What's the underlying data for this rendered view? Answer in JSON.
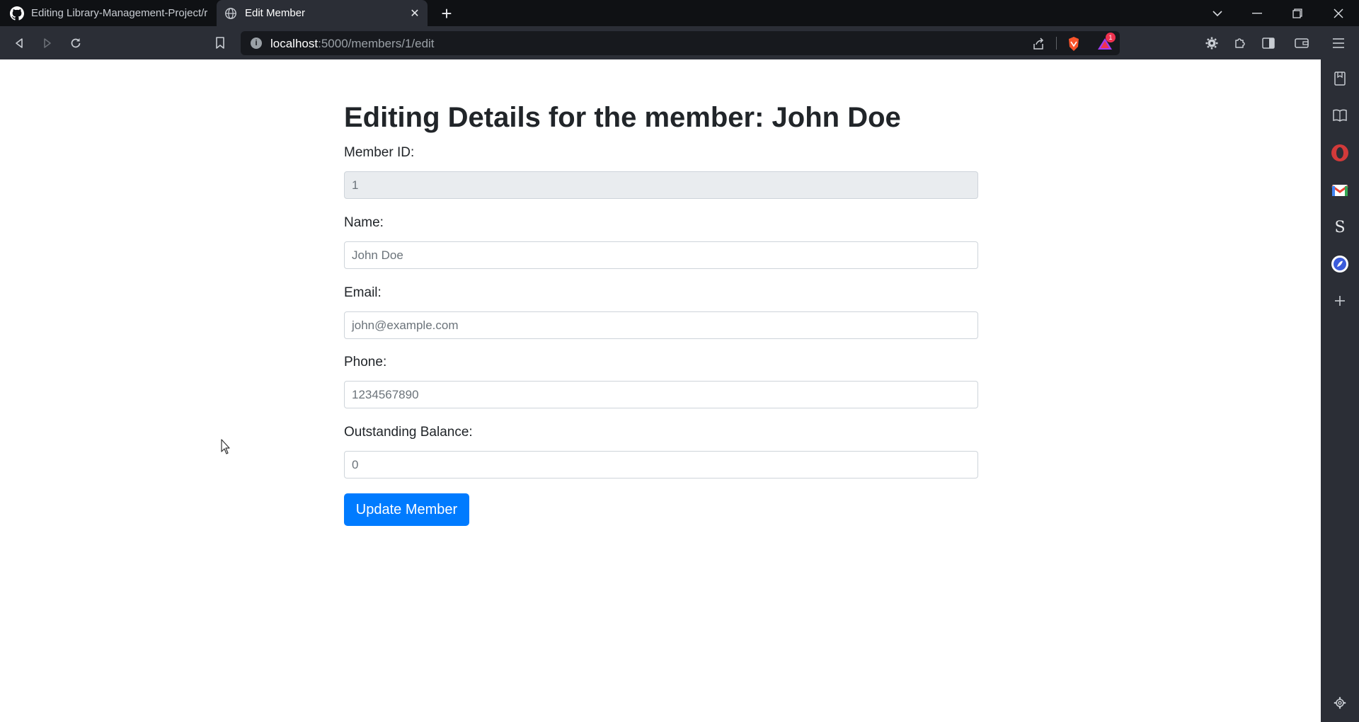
{
  "browser": {
    "tabs": [
      {
        "title": "Editing Library-Management-Project/r",
        "icon": "github-icon",
        "active": false
      },
      {
        "title": "Edit Member",
        "icon": "globe-icon",
        "active": true
      }
    ],
    "url_host": "localhost",
    "url_path": ":5000/members/1/edit",
    "notification_count": "1"
  },
  "page": {
    "heading": "Editing Details for the member: John Doe",
    "fields": {
      "member_id": {
        "label": "Member ID:",
        "value": "1"
      },
      "name": {
        "label": "Name:",
        "value": "John Doe"
      },
      "email": {
        "label": "Email:",
        "value": "john@example.com"
      },
      "phone": {
        "label": "Phone:",
        "value": "1234567890"
      },
      "balance": {
        "label": "Outstanding Balance:",
        "value": "0"
      }
    },
    "submit_label": "Update Member"
  },
  "colors": {
    "accent": "#007bff",
    "chrome_dark": "#0f1114",
    "chrome_toolbar": "#2b2e36"
  }
}
